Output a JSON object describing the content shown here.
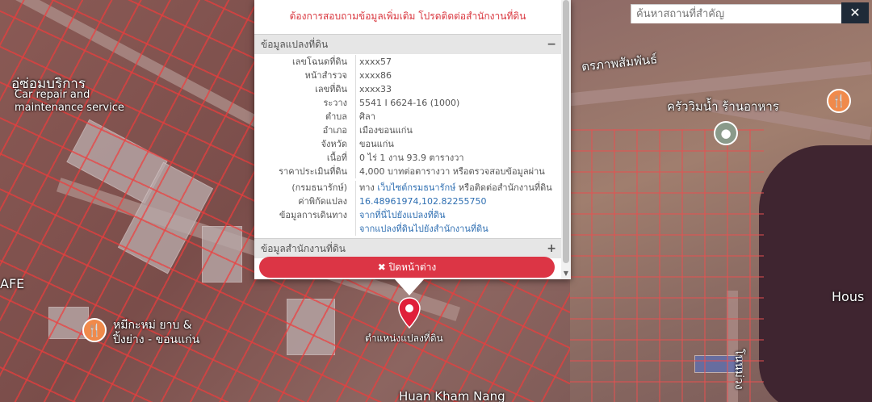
{
  "search": {
    "placeholder": "ค้นหาสถานที่สำคัญ",
    "close_icon": "✕"
  },
  "popup": {
    "notice_top": "ต้องการสอบถามข้อมูลเพิ่มเติม โปรดติดต่อสำนักงานที่ดิน",
    "parcel_section": {
      "title": "ข้อมูลแปลงที่ดิน",
      "toggle": "−",
      "rows": [
        {
          "label": "เลขโฉนดที่ดิน",
          "value": "xxxx57"
        },
        {
          "label": "หน้าสำรวจ",
          "value": "xxxx86"
        },
        {
          "label": "เลขที่ดิน",
          "value": "xxxx33"
        },
        {
          "label": "ระวาง",
          "value": "5541 I 6624-16 (1000)"
        },
        {
          "label": "ตำบล",
          "value": "ศิลา"
        },
        {
          "label": "อำเภอ",
          "value": "เมืองขอนแก่น"
        },
        {
          "label": "จังหวัด",
          "value": "ขอนแก่น"
        },
        {
          "label": "เนื้อที่",
          "value": "0 ไร่ 1 งาน 93.9 ตารางวา"
        },
        {
          "label": "ราคาประเมินที่ดิน",
          "value": "4,000 บาทต่อตารางวา หรือตรวจสอบข้อมูลผ่าน"
        }
      ],
      "row_department": {
        "label": "(กรมธนารักษ์)",
        "pre": "ทาง",
        "link": "เว็บไซต์กรมธนารักษ์",
        "post": " หรือติดต่อสำนักงานที่ดิน"
      },
      "row_coords": {
        "label": "ค่าพิกัดแปลง",
        "value": "16.48961974,102.82255750"
      },
      "row_travel": {
        "label": "ข้อมูลการเดินทาง",
        "link1": "จากที่นี่ไปยังแปลงที่ดิน",
        "link2": "จากแปลงที่ดินไปยังสำนักงานที่ดิน"
      }
    },
    "office_section": {
      "title": "ข้อมูลสำนักงานที่ดิน",
      "toggle": "+"
    },
    "close_button": "✖ ปิดหน้าต่าง"
  },
  "map": {
    "pin_label": "ตำแหน่งแปลงที่ดิน",
    "labels": {
      "car_repair_1": "Car repair and",
      "car_repair_2": "maintenance service",
      "thai_top_left": "อู่ซ่อมบริการ",
      "afe": "AFE",
      "restaurant_left_1": "หมีกะหม่ ยาบ &",
      "restaurant_left_2": "ปิ้งย่าง - ขอนแก่น",
      "road_top_right": "ตรภาพสัมพันธ์",
      "restaurant_right": "ครัววิมน้ำ ร้านอาหาร",
      "house": "Hous",
      "bottom_place": "Huan Kham Nang",
      "road_vertical": "โนนม่วง"
    },
    "colors": {
      "parcel_line": "#f03c3c",
      "pin": "#e0203a",
      "accent": "#dc3545"
    }
  }
}
